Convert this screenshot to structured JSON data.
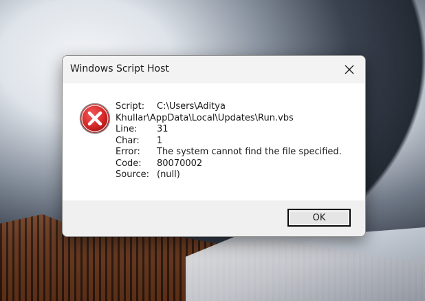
{
  "dialog": {
    "title": "Windows Script Host",
    "close_icon": "close-icon",
    "icon": "error-icon",
    "fields": {
      "script_label": "Script:",
      "script_value_line1": "C:\\Users\\Aditya",
      "script_value_line2": "Khullar\\AppData\\Local\\Updates\\Run.vbs",
      "line_label": "Line:",
      "line_value": "31",
      "char_label": "Char:",
      "char_value": "1",
      "error_label": "Error:",
      "error_value": "The system cannot find the file specified.",
      "code_label": "Code:",
      "code_value": "80070002",
      "source_label": "Source:",
      "source_value": "(null)"
    },
    "ok_label": "OK",
    "colors": {
      "error_red": "#d92b2b",
      "titlebar": "#f3f3f3",
      "footer": "#f0f0f0"
    }
  }
}
